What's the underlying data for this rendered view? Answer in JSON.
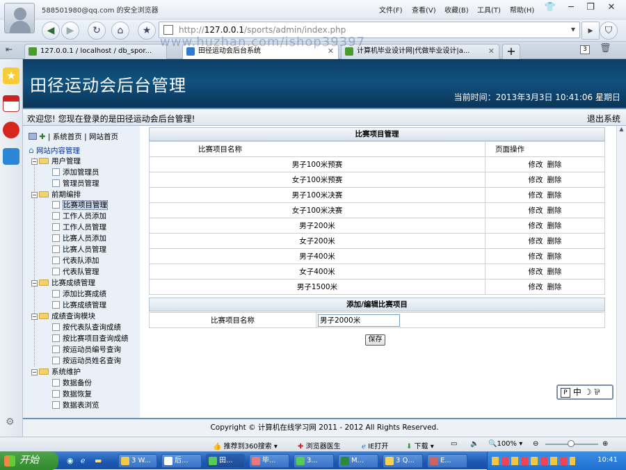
{
  "browser": {
    "account": "588501980@qq.com 的安全浏览器",
    "menu": [
      "文件(F)",
      "查看(V)",
      "收藏(B)",
      "工具(T)",
      "帮助(H)"
    ],
    "url_gray": "http://",
    "url_host": "127.0.0.1",
    "url_path": "/sports/admin/index.php",
    "tabs": [
      {
        "label": "127.0.0.1 / localhost / db_spor..."
      },
      {
        "label": "田径运动会后台系统"
      },
      {
        "label": "计算机毕业设计网|代做毕业设计|a..."
      }
    ],
    "tab_count": "3"
  },
  "watermark": "www.huzhan.com/ishop39397",
  "site": {
    "title": "田径运动会后台管理",
    "clock": "当前时间：2013年3月3日  10:41:06 星期日",
    "welcome": "欢迎您! 您现在登录的是田径运动会后台管理!",
    "logout": "退出系统"
  },
  "sidebar": {
    "top_links": [
      "系统首页",
      "网站首页"
    ],
    "root": "网站内容管理",
    "groups": [
      {
        "label": "用户管理",
        "items": [
          "添加管理员",
          "管理员管理"
        ]
      },
      {
        "label": "前期编排",
        "items": [
          "比赛项目管理",
          "工作人员添加",
          "工作人员管理",
          "比赛人员添加",
          "比赛人员管理",
          "代表队添加",
          "代表队管理"
        ]
      },
      {
        "label": "比赛成绩管理",
        "items": [
          "添加比赛成绩",
          "比赛成绩管理"
        ]
      },
      {
        "label": "成绩查询模块",
        "items": [
          "按代表队查询成绩",
          "按比赛项目查询成绩",
          "按运动员编号查询",
          "按运动员姓名查询"
        ]
      },
      {
        "label": "系统维护",
        "items": [
          "数据备份",
          "数据恢复",
          "数据表浏览"
        ]
      }
    ]
  },
  "events_panel": {
    "title": "比赛项目管理",
    "col_name": "比赛项目名称",
    "col_ops": "页面操作",
    "edit_label": "修改",
    "delete_label": "删除",
    "rows": [
      "男子100米预赛",
      "女子100米预赛",
      "男子100米决赛",
      "女子100米决赛",
      "男子200米",
      "女子200米",
      "男子400米",
      "女子400米",
      "男子1500米"
    ]
  },
  "form_panel": {
    "title": "添加/编辑比赛项目",
    "field_label": "比赛项目名称",
    "field_value": "男子2000米",
    "save_label": "保存"
  },
  "ime": "中 ☽ ⅌",
  "footer": "Copyright © 计算机在线学习网  2011 - 2012 All Rights Reserved.",
  "statusbar": {
    "items": [
      "推荐到360搜索",
      "浏览器医生",
      "IE打开",
      "下载",
      "100%"
    ]
  },
  "taskbar": {
    "start": "开始",
    "buttons": [
      "3 W...",
      "后...",
      "田...",
      "毕...",
      "3...",
      "M...",
      "3 Q...",
      "E..."
    ],
    "time": "10:41"
  }
}
